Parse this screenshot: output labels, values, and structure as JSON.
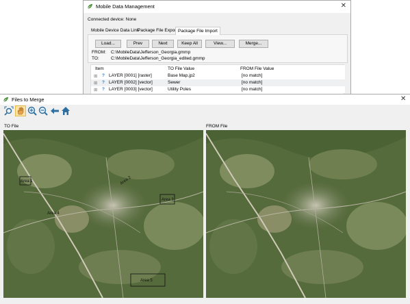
{
  "mdm": {
    "title": "Mobile Data Management",
    "connected": "Connected device: None",
    "tabs": [
      "Mobile Device Data Link",
      "Package File Export",
      "Package File Import"
    ],
    "buttons": [
      "Load...",
      "Prev",
      "Next",
      "Keep All",
      "View...",
      "Merge..."
    ],
    "from_label": "FROM:",
    "from_path": "C:\\MobileData\\Jefferson_Georgia.gmmp",
    "to_label": "TO:",
    "to_path": "C:\\MobileData\\Jefferson_Georgia_edited.gmmp",
    "columns": [
      "Item",
      "TO File Value",
      "FROM File Value"
    ],
    "rows": [
      {
        "item": "LAYER [0001] [raster]",
        "to": "Base Map.jp2",
        "from": "[no match]"
      },
      {
        "item": "LAYER [0002] [vector]",
        "to": "Sewer",
        "from": "[no match]"
      },
      {
        "item": "LAYER [0003] [vector]",
        "to": "Utility Poles",
        "from": "[no match]"
      }
    ],
    "close_glyph": "✕"
  },
  "ftm": {
    "title": "Files to Merge",
    "close_glyph": "✕",
    "toolbar_icons": [
      "zoom-to-extents-icon",
      "pan-hand-icon",
      "zoom-in-icon",
      "zoom-out-icon",
      "back-arrow-icon",
      "home-icon"
    ],
    "to_label": "TO File",
    "from_label": "FROM File",
    "map_labels": [
      "Area 1",
      "Area 2",
      "Area 3",
      "Area 4",
      "Area 5"
    ]
  }
}
